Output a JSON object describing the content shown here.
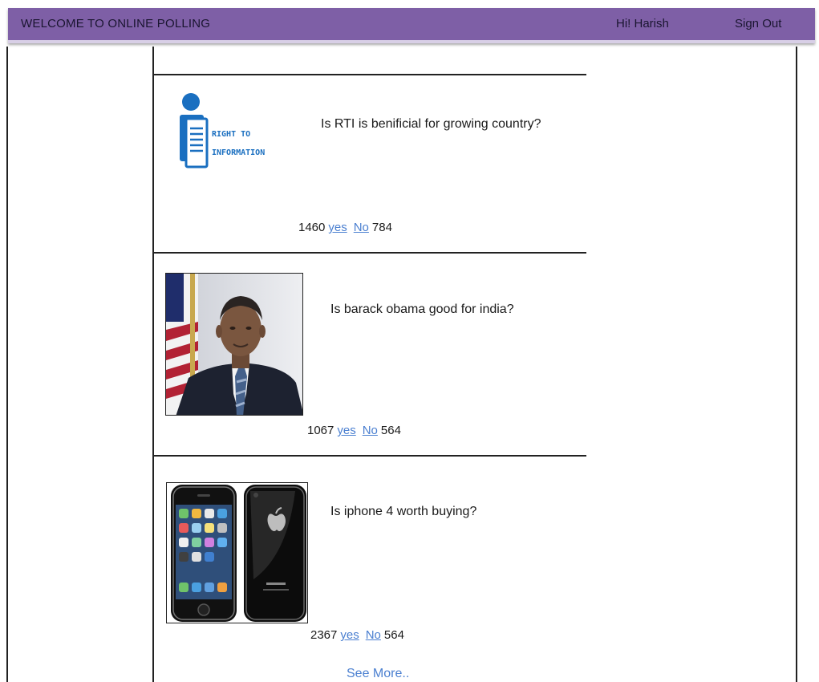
{
  "header": {
    "title": "WELCOME TO ONLINE POLLING",
    "greeting": "Hi! Harish",
    "sign_out": "Sign Out"
  },
  "colors": {
    "header_bg": "#7e5fa6",
    "link": "#4a7fd0"
  },
  "polls": [
    {
      "question": "Is RTI is benificial  for growing country?",
      "image_icon": "right-to-information-logo",
      "image_text_line1": "RIGHT TO",
      "image_text_line2": "INFORMATION",
      "yes_count": "1460",
      "yes_label": "yes",
      "no_label": "No",
      "no_count": "784"
    },
    {
      "question": "Is barack obama good for india?",
      "image_icon": "portrait-photo",
      "yes_count": "1067",
      "yes_label": "yes",
      "no_label": "No",
      "no_count": "564"
    },
    {
      "question": "Is iphone  4 worth buying?",
      "image_icon": "smartphone-photo",
      "yes_count": "2367",
      "yes_label": "yes",
      "no_label": "No",
      "no_count": "564"
    }
  ],
  "see_more": "See More.."
}
